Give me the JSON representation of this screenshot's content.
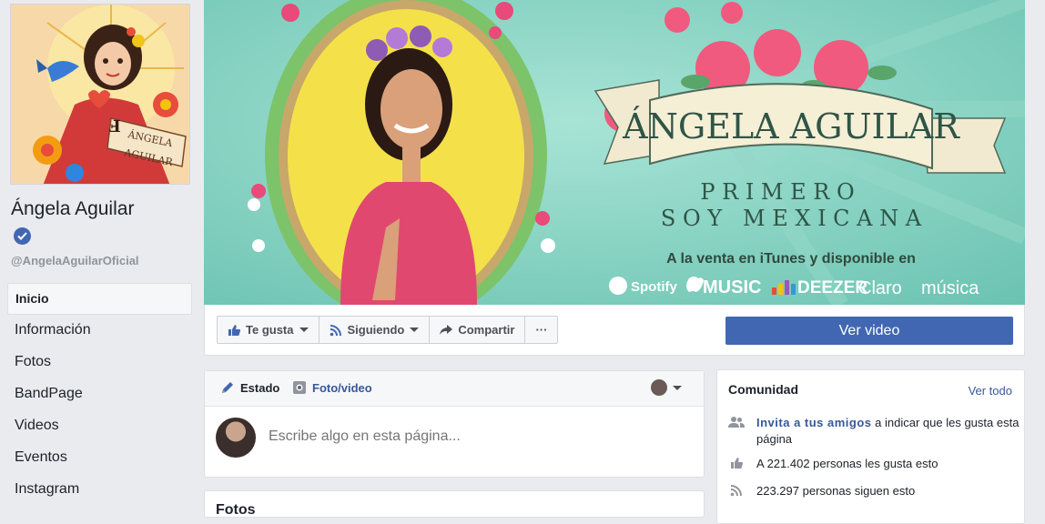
{
  "sidebar": {
    "page_name": "Ángela Aguilar",
    "handle": "@AngelaAguilarOficial",
    "nav": [
      {
        "label": "Inicio",
        "active": true
      },
      {
        "label": "Información"
      },
      {
        "label": "Fotos"
      },
      {
        "label": "BandPage"
      },
      {
        "label": "Videos"
      },
      {
        "label": "Eventos"
      },
      {
        "label": "Instagram"
      }
    ],
    "avatar_text": {
      "top": "ÁNGELA",
      "bottom": "AGUILAR"
    }
  },
  "cover": {
    "title": "ÁNGELA AGUILAR",
    "subtitle_line1": "P R I M E R O",
    "subtitle_line2": "S O Y   M E X I C A N A",
    "sale_text": "A la venta en iTunes y disponible en",
    "services": [
      "Spotify",
      "MUSIC",
      "DEEZER",
      "Claro",
      "música"
    ]
  },
  "actions": {
    "like_label": "Te gusta",
    "following_label": "Siguiendo",
    "share_label": "Compartir",
    "more_label": "···",
    "cta_label": "Ver video"
  },
  "composer": {
    "tab_status": "Estado",
    "tab_photo": "Foto/video",
    "placeholder": "Escribe algo en esta página..."
  },
  "photos_section": {
    "title": "Fotos"
  },
  "community": {
    "title": "Comunidad",
    "see_all": "Ver todo",
    "invite_link": "Invita a tus amigos",
    "invite_rest": " a indicar que les gusta esta página",
    "likes_text": "A 221.402 personas les gusta esto",
    "followers_text": "223.297 personas siguen esto"
  },
  "colors": {
    "brand_blue": "#4267b2",
    "link_blue": "#365899",
    "page_bg": "#e9ebee",
    "cover_teal": "#7fd0c0",
    "cover_yellow": "#f4e14a"
  }
}
